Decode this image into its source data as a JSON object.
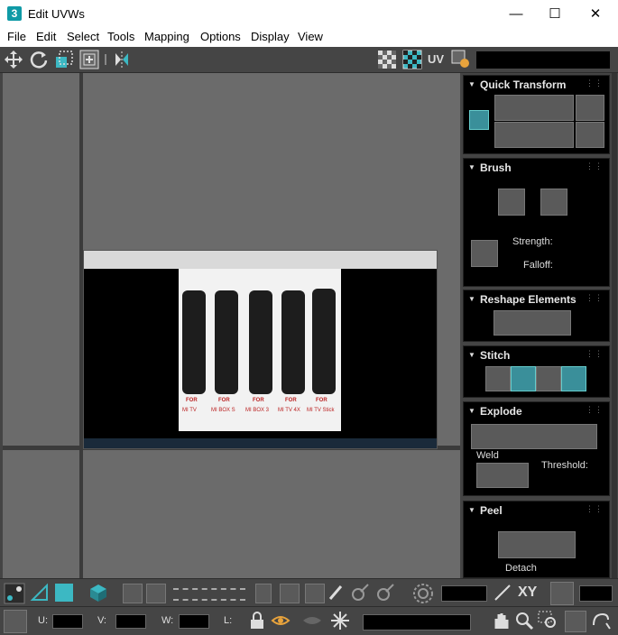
{
  "window": {
    "app_icon_text": "3",
    "title": "Edit UVWs",
    "minimize": "—",
    "maximize": "☐",
    "close": "✕"
  },
  "menu": [
    "File",
    "Edit",
    "Select",
    "Tools",
    "Mapping",
    "Options",
    "Display",
    "View"
  ],
  "toolbar": {
    "uv_label": "UV"
  },
  "rollouts": {
    "quick_transform": {
      "title": "Quick Transform"
    },
    "brush": {
      "title": "Brush",
      "strength_label": "Strength:",
      "falloff_label": "Falloff:"
    },
    "reshape": {
      "title": "Reshape Elements"
    },
    "stitch": {
      "title": "Stitch"
    },
    "explode": {
      "title": "Explode",
      "weld_label": "Weld",
      "threshold_label": "Threshold:"
    },
    "peel": {
      "title": "Peel",
      "detach_label": "Detach"
    }
  },
  "bottom": {
    "xy_label": "XY",
    "u_label": "U:",
    "v_label": "V:",
    "w_label": "W:",
    "l_label": "L:"
  },
  "texture": {
    "labels": [
      "FOR",
      "FOR",
      "FOR",
      "FOR",
      "FOR"
    ],
    "sublabels": [
      "MI TV",
      "MI BOX S",
      "MI BOX 3",
      "MI TV 4X",
      "MI TV Stick"
    ]
  },
  "colors": {
    "accent": "#3cb8c3",
    "panel_bg": "#000000",
    "toolbar_bg": "#454545",
    "viewport_bg": "#6b6b6b"
  }
}
